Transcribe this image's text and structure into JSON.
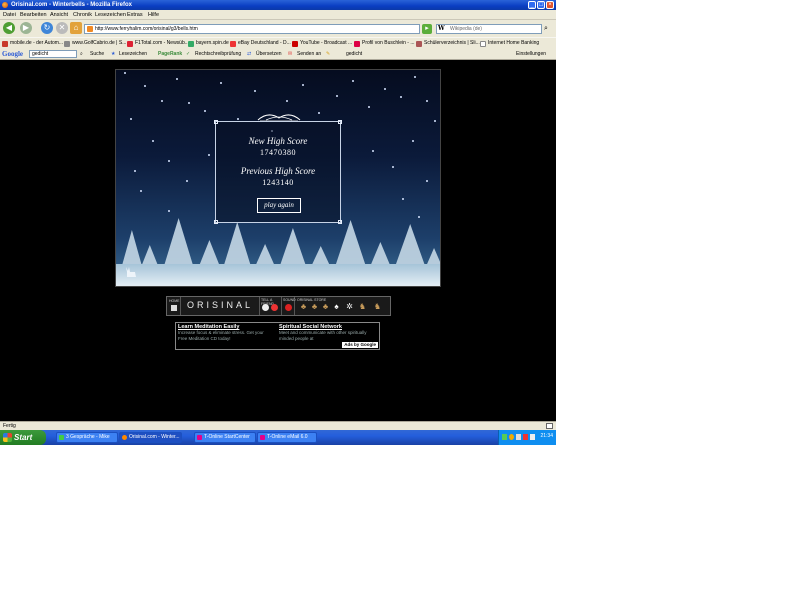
{
  "window": {
    "title": "Orisinal.com - Winterbells - Mozilla Firefox"
  },
  "menu": [
    "Datei",
    "Bearbeiten",
    "Ansicht",
    "Chronik",
    "Lesezeichen",
    "Extras",
    "Hilfe"
  ],
  "nav": {
    "url": "http://www.ferryhalim.com/orisinal/g3/bells.htm",
    "search_value": "Wikipedia (de)"
  },
  "bookmarks": [
    "mobile.de - der Autom...",
    "www.GolfCabrio.de | S...",
    "F1Total.com - Newsüb...",
    "bayern.spin.de",
    "eBay Deutschland - D...",
    "YouTube - Broadcast ...",
    "Profil von Buschlein - ...",
    "Schülerverzeichnis | Sli...",
    "Internet Home Banking"
  ],
  "googlebar": {
    "logo": "Google",
    "query": "gedicht",
    "items": [
      "Suche",
      "Lesezeichen",
      "PageRank",
      "Rechtschreibprüfung",
      "Übersetzen",
      "Senden an",
      "gedicht"
    ],
    "settings": "Einstellungen"
  },
  "game": {
    "new_high_label": "New High Score",
    "new_high_value": "17470380",
    "prev_high_label": "Previous High Score",
    "prev_high_value": "1243140",
    "play_again": "play again"
  },
  "orisinal_bar": {
    "home": "HOME",
    "brand": "ORISINAL",
    "tell_friend": "TELL A FRIEND",
    "sound": "SOUND",
    "store": "ORISINAL STORE"
  },
  "ads": {
    "items": [
      {
        "title": "Learn Meditation Easily",
        "text": "Increase focus & eliminate stress. Get your Free Meditation CD today!"
      },
      {
        "title": "Spiritual Social Network",
        "text": "Meet and communicate with other spiritually minded people at"
      }
    ],
    "ads_by": "Ads by Google"
  },
  "status": "Fertig",
  "taskbar": {
    "start": "Start",
    "tasks": [
      "3 Gespräche - Mike",
      "Orisinal.com - Winter...",
      "T-Online StartCenter ...",
      "T-Online eMail 6.0"
    ],
    "active_index": 1,
    "clock": "21:34"
  }
}
